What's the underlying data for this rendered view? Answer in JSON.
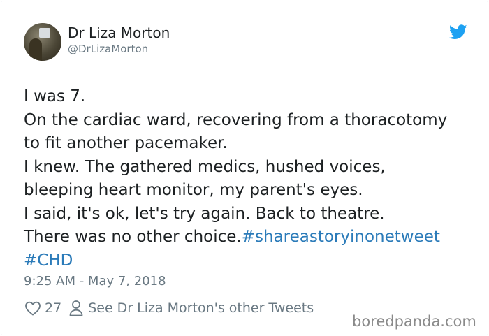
{
  "author": {
    "name": "Dr Liza Morton",
    "handle": "@DrLizaMorton"
  },
  "brand_icon": "twitter-bird-icon",
  "colors": {
    "text": "#1c2022",
    "muted": "#697882",
    "link": "#2b7bb9",
    "brand": "#1da1f2"
  },
  "tweet": {
    "lines": [
      "I was 7.",
      "On the cardiac ward, recovering from a thoracotomy",
      "to fit another pacemaker.",
      "I knew. The gathered medics, hushed voices,",
      "bleeping heart monitor, my parent's eyes.",
      "I said, it's ok, let's try again. Back to theatre."
    ],
    "last_line_text": "There was no other choice.",
    "hashtags": [
      "#shareastoryinonetweet",
      "#CHD"
    ]
  },
  "timestamp": "9:25 AM - May 7, 2018",
  "actions": {
    "like_count": "27",
    "like_icon": "heart-outline-icon",
    "see_more_label": "See Dr Liza Morton's other Tweets",
    "see_more_icon": "person-outline-icon"
  },
  "watermark": "boredpanda.com"
}
